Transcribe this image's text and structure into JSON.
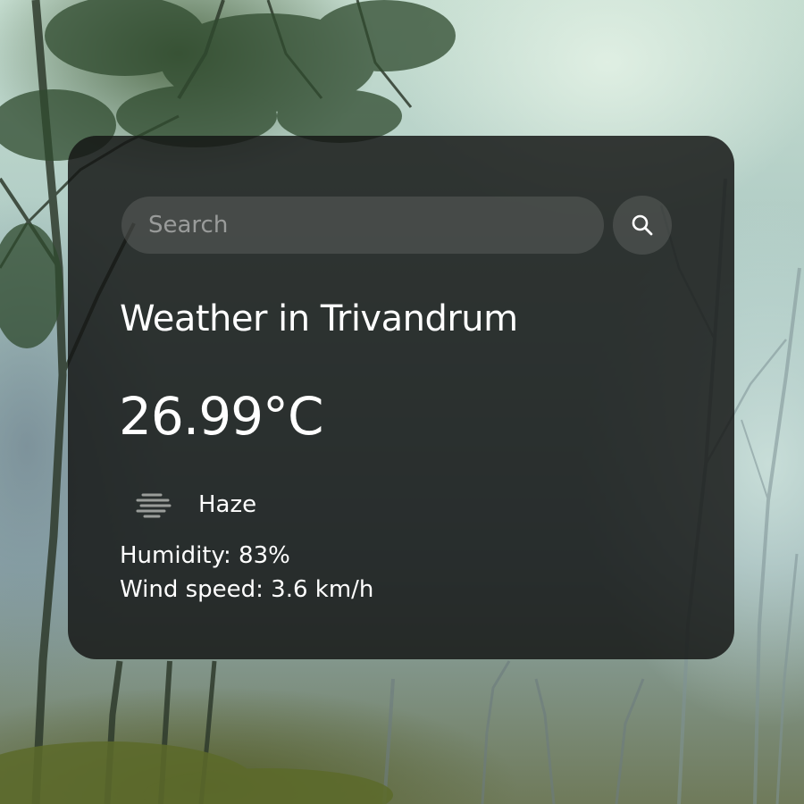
{
  "search": {
    "placeholder": "Search",
    "value": "",
    "button_icon": "search-icon"
  },
  "weather": {
    "title": "Weather in Trivandrum",
    "temperature": "26.99°C",
    "condition": "Haze",
    "condition_icon": "haze-icon",
    "humidity": "Humidity: 83%",
    "wind": "Wind speed: 3.6 km/h"
  },
  "colors": {
    "card_background": "#141614",
    "text": "#ffffff",
    "input_background": "#5f625f"
  }
}
